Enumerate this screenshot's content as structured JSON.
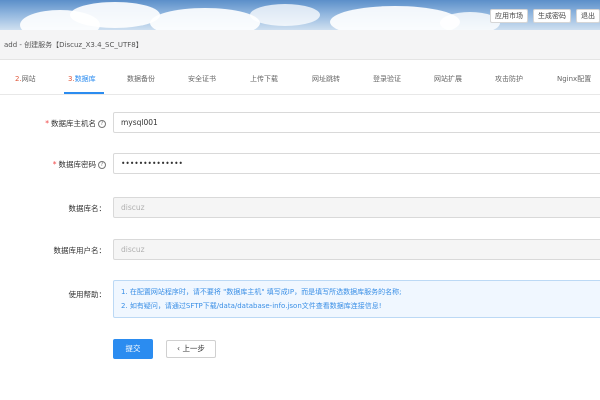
{
  "top_buttons": [
    "应用市场",
    "生成密码",
    "退出"
  ],
  "breadcrumb": "add - 创建服务【Discuz_X3.4_SC_UTF8】",
  "tabs": [
    {
      "num": "2.",
      "label": "网站"
    },
    {
      "num": "3.",
      "label": "数据库"
    },
    {
      "label": "数据备份"
    },
    {
      "label": "安全证书"
    },
    {
      "label": "上传下载"
    },
    {
      "label": "网址跳转"
    },
    {
      "label": "登录验证"
    },
    {
      "label": "网站扩展"
    },
    {
      "label": "攻击防护"
    },
    {
      "label": "Nginx配置"
    }
  ],
  "form": {
    "host_label": "数据库主机名",
    "host_value": "mysql001",
    "password_label": "数据库密码",
    "password_value": "••••••••••••••",
    "dbname_label": "数据库名：",
    "dbname_value": "discuz",
    "dbuser_label": "数据库用户名：",
    "dbuser_value": "discuz",
    "help_label": "使用帮助：",
    "help_line1": "1. 在配置网站程序时，请不要将 \"数据库主机\" 填写成IP，而是填写所选数据库服务的名称;",
    "help_line2": "2. 如有疑问，请通过SFTP下载/data/database-info.json文件查看数据库连接信息!"
  },
  "buttons": {
    "submit": "提交",
    "prev": "上一步"
  },
  "icons": {
    "help": "question-circle-icon",
    "prev": "chevron-left-icon"
  },
  "colors": {
    "primary": "#2b8cf0",
    "required": "#f04848",
    "step_number": "#e05a3d",
    "help_text": "#3a8fe6"
  }
}
